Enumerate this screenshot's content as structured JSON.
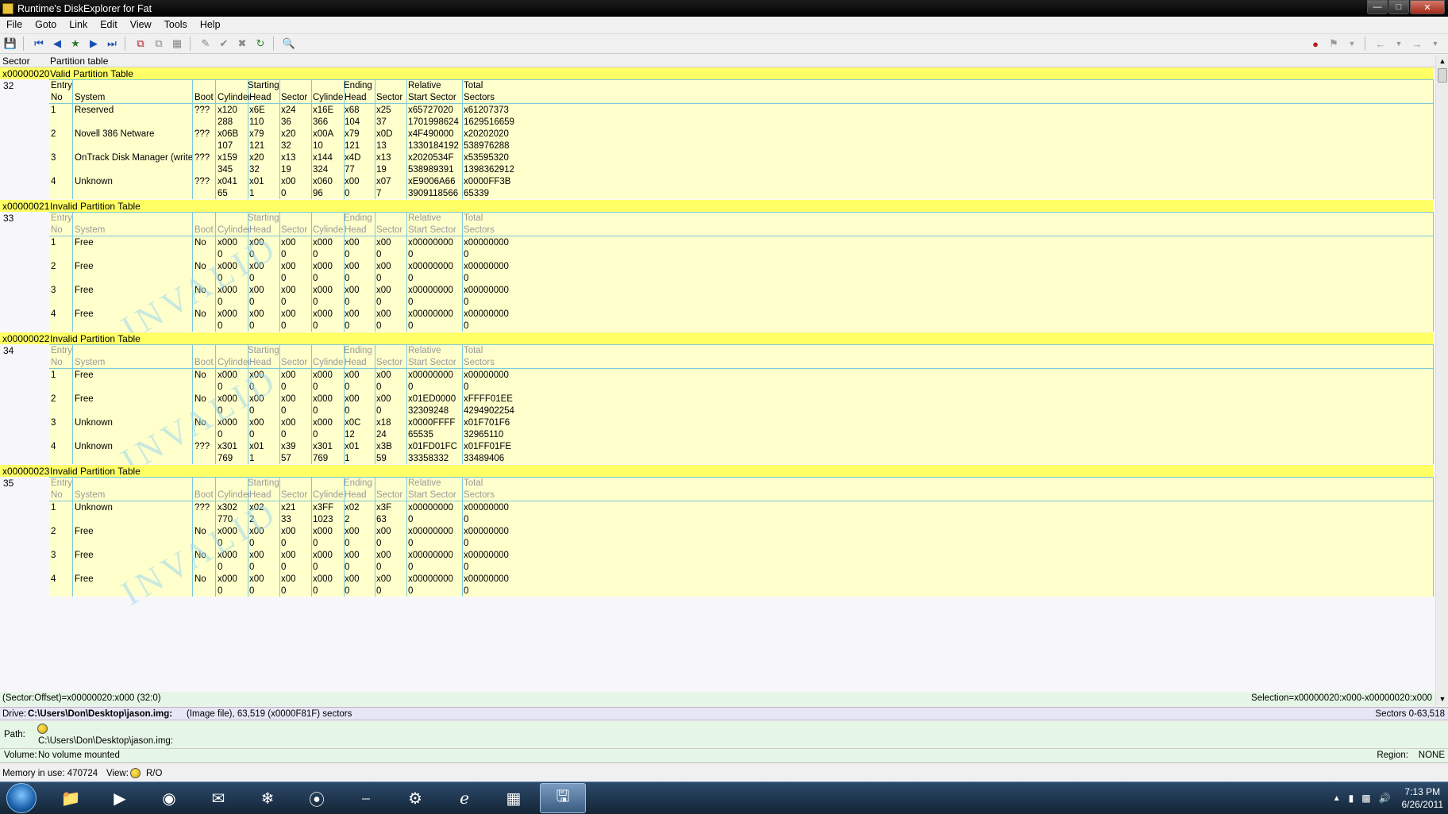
{
  "window": {
    "title": "Runtime's DiskExplorer for Fat"
  },
  "menu": [
    "File",
    "Goto",
    "Link",
    "Edit",
    "View",
    "Tools",
    "Help"
  ],
  "header": {
    "sector": "Sector",
    "type": "Partition table"
  },
  "columns": {
    "top": {
      "entry": "Entry",
      "starting": "Starting",
      "ending": "Ending",
      "relative": "Relative",
      "total": "Total"
    },
    "bottom": {
      "no": "No",
      "system": "System",
      "boot": "Boot",
      "cyl": "Cylinder",
      "head": "Head",
      "sector": "Sector",
      "start_sector": "Start Sector",
      "sectors": "Sectors"
    }
  },
  "blocks": [
    {
      "addr": "x00000020",
      "label": "Valid Partition Table",
      "num": "32",
      "valid": true,
      "entries": [
        {
          "no": "1",
          "system": "Reserved",
          "boot": "???",
          "r1": [
            "x120",
            "x6E",
            "x24",
            "x16E",
            "x68",
            "x25",
            "x65727020",
            "x61207373"
          ],
          "r2": [
            "288",
            "110",
            "36",
            "366",
            "104",
            "37",
            "1701998624",
            "1629516659"
          ]
        },
        {
          "no": "2",
          "system": "Novell 386 Netware",
          "boot": "???",
          "r1": [
            "x06B",
            "x79",
            "x20",
            "x00A",
            "x79",
            "x0D",
            "x4F490000",
            "x20202020"
          ],
          "r2": [
            "107",
            "121",
            "32",
            "10",
            "121",
            "13",
            "1330184192",
            "538976288"
          ]
        },
        {
          "no": "3",
          "system": "OnTrack Disk Manager (write-o",
          "boot": "???",
          "r1": [
            "x159",
            "x20",
            "x13",
            "x144",
            "x4D",
            "x13",
            "x2020534F",
            "x53595320"
          ],
          "r2": [
            "345",
            "32",
            "19",
            "324",
            "77",
            "19",
            "538989391",
            "1398362912"
          ]
        },
        {
          "no": "4",
          "system": "Unknown",
          "boot": "???",
          "r1": [
            "x041",
            "x01",
            "x00",
            "x060",
            "x00",
            "x07",
            "xE9006A66",
            "x0000FF3B"
          ],
          "r2": [
            "65",
            "1",
            "0",
            "96",
            "0",
            "7",
            "3909118566",
            "65339"
          ]
        }
      ]
    },
    {
      "addr": "x00000021",
      "label": "Invalid Partition Table",
      "num": "33",
      "valid": false,
      "entries": [
        {
          "no": "1",
          "system": "Free",
          "boot": "No",
          "r1": [
            "x000",
            "x00",
            "x00",
            "x000",
            "x00",
            "x00",
            "x00000000",
            "x00000000"
          ],
          "r2": [
            "0",
            "0",
            "0",
            "0",
            "0",
            "0",
            "0",
            "0"
          ]
        },
        {
          "no": "2",
          "system": "Free",
          "boot": "No",
          "r1": [
            "x000",
            "x00",
            "x00",
            "x000",
            "x00",
            "x00",
            "x00000000",
            "x00000000"
          ],
          "r2": [
            "0",
            "0",
            "0",
            "0",
            "0",
            "0",
            "0",
            "0"
          ]
        },
        {
          "no": "3",
          "system": "Free",
          "boot": "No",
          "r1": [
            "x000",
            "x00",
            "x00",
            "x000",
            "x00",
            "x00",
            "x00000000",
            "x00000000"
          ],
          "r2": [
            "0",
            "0",
            "0",
            "0",
            "0",
            "0",
            "0",
            "0"
          ]
        },
        {
          "no": "4",
          "system": "Free",
          "boot": "No",
          "r1": [
            "x000",
            "x00",
            "x00",
            "x000",
            "x00",
            "x00",
            "x00000000",
            "x00000000"
          ],
          "r2": [
            "0",
            "0",
            "0",
            "0",
            "0",
            "0",
            "0",
            "0"
          ]
        }
      ]
    },
    {
      "addr": "x00000022",
      "label": "Invalid Partition Table",
      "num": "34",
      "valid": false,
      "entries": [
        {
          "no": "1",
          "system": "Free",
          "boot": "No",
          "r1": [
            "x000",
            "x00",
            "x00",
            "x000",
            "x00",
            "x00",
            "x00000000",
            "x00000000"
          ],
          "r2": [
            "0",
            "0",
            "0",
            "0",
            "0",
            "0",
            "0",
            "0"
          ]
        },
        {
          "no": "2",
          "system": "Free",
          "boot": "No",
          "r1": [
            "x000",
            "x00",
            "x00",
            "x000",
            "x00",
            "x00",
            "x01ED0000",
            "xFFFF01EE"
          ],
          "r2": [
            "0",
            "0",
            "0",
            "0",
            "0",
            "0",
            "32309248",
            "4294902254"
          ]
        },
        {
          "no": "3",
          "system": "Unknown",
          "boot": "No",
          "r1": [
            "x000",
            "x00",
            "x00",
            "x000",
            "x0C",
            "x18",
            "x0000FFFF",
            "x01F701F6"
          ],
          "r2": [
            "0",
            "0",
            "0",
            "0",
            "12",
            "24",
            "65535",
            "32965110"
          ]
        },
        {
          "no": "4",
          "system": "Unknown",
          "boot": "???",
          "r1": [
            "x301",
            "x01",
            "x39",
            "x301",
            "x01",
            "x3B",
            "x01FD01FC",
            "x01FF01FE"
          ],
          "r2": [
            "769",
            "1",
            "57",
            "769",
            "1",
            "59",
            "33358332",
            "33489406"
          ]
        }
      ]
    },
    {
      "addr": "x00000023",
      "label": "Invalid Partition Table",
      "num": "35",
      "valid": false,
      "entries": [
        {
          "no": "1",
          "system": "Unknown",
          "boot": "???",
          "r1": [
            "x302",
            "x02",
            "x21",
            "x3FF",
            "x02",
            "x3F",
            "x00000000",
            "x00000000"
          ],
          "r2": [
            "770",
            "2",
            "33",
            "1023",
            "2",
            "63",
            "0",
            "0"
          ]
        },
        {
          "no": "2",
          "system": "Free",
          "boot": "No",
          "r1": [
            "x000",
            "x00",
            "x00",
            "x000",
            "x00",
            "x00",
            "x00000000",
            "x00000000"
          ],
          "r2": [
            "0",
            "0",
            "0",
            "0",
            "0",
            "0",
            "0",
            "0"
          ]
        },
        {
          "no": "3",
          "system": "Free",
          "boot": "No",
          "r1": [
            "x000",
            "x00",
            "x00",
            "x000",
            "x00",
            "x00",
            "x00000000",
            "x00000000"
          ],
          "r2": [
            "0",
            "0",
            "0",
            "0",
            "0",
            "0",
            "0",
            "0"
          ]
        },
        {
          "no": "4",
          "system": "Free",
          "boot": "No",
          "r1": [
            "x000",
            "x00",
            "x00",
            "x000",
            "x00",
            "x00",
            "x00000000",
            "x00000000"
          ],
          "r2": [
            "0",
            "0",
            "0",
            "0",
            "0",
            "0",
            "0",
            "0"
          ]
        }
      ]
    }
  ],
  "status": {
    "offset": "(Sector:Offset)=x00000020:x000 (32:0)",
    "selection": "Selection=x00000020:x000-x00000020:x000",
    "drive_label": "Drive:",
    "drive_path": "C:\\Users\\Don\\Desktop\\jason.img:",
    "drive_info": "(Image file), 63,519 (x0000F81F) sectors",
    "sectors_range": "Sectors 0-63,518",
    "path_label": "Path:",
    "path_value": "C:\\Users\\Don\\Desktop\\jason.img:",
    "volume_label": "Volume:",
    "volume_value": "No volume mounted",
    "region_label": "Region:",
    "region_value": "NONE",
    "memory": "Memory in use: 470724",
    "view_label": "View:",
    "ro": "R/O"
  },
  "taskbar": {
    "time": "7:13 PM",
    "date": "6/26/2011"
  },
  "colors": {
    "title_bg": "#ffff66",
    "body_bg": "#ffffcc",
    "grid": "#7cc9d9",
    "watermark": "#9fd8ec"
  },
  "icons": [
    "save-icon",
    "first-icon",
    "prev-icon",
    "home-icon",
    "next-icon",
    "last-icon",
    "copy-icon",
    "paste-icon",
    "check-icon",
    "cancel-icon",
    "refresh-icon",
    "find-icon"
  ]
}
